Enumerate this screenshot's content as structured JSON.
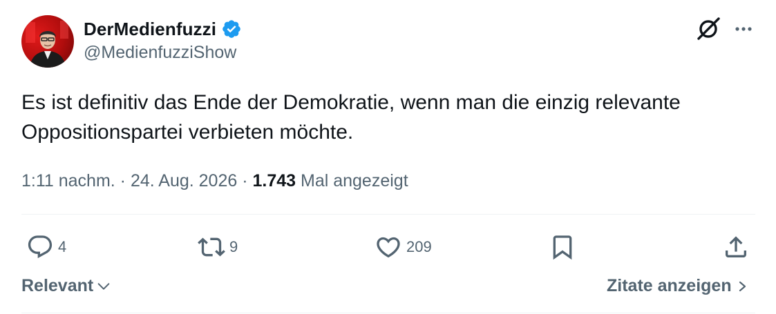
{
  "author": {
    "display_name": "DerMedienfuzzi",
    "handle": "@MedienfuzziShow",
    "verified": true
  },
  "tweet": {
    "text_line1": "Es ist definitiv das Ende der Demokratie, wenn man die einzig relevante",
    "text_line2": "Oppositionspartei verbieten möchte."
  },
  "meta": {
    "time": "1:11 nachm.",
    "separator1": " · ",
    "date": "24. Aug. 2026",
    "separator2": " · ",
    "views_count": "1.743",
    "views_label": " Mal angezeigt"
  },
  "actions": {
    "replies": "4",
    "reposts": "9",
    "likes": "209"
  },
  "footer": {
    "sort_label": "Relevant",
    "quotes_label": "Zitate anzeigen"
  },
  "colors": {
    "text": "#0f1419",
    "secondary": "#536471",
    "verified": "#1d9bf0",
    "divider": "#eff3f4"
  },
  "icons": [
    "verified-badge-icon",
    "grok-icon",
    "more-icon",
    "reply-icon",
    "repost-icon",
    "like-icon",
    "bookmark-icon",
    "share-icon",
    "chevron-down-icon",
    "chevron-right-icon"
  ]
}
